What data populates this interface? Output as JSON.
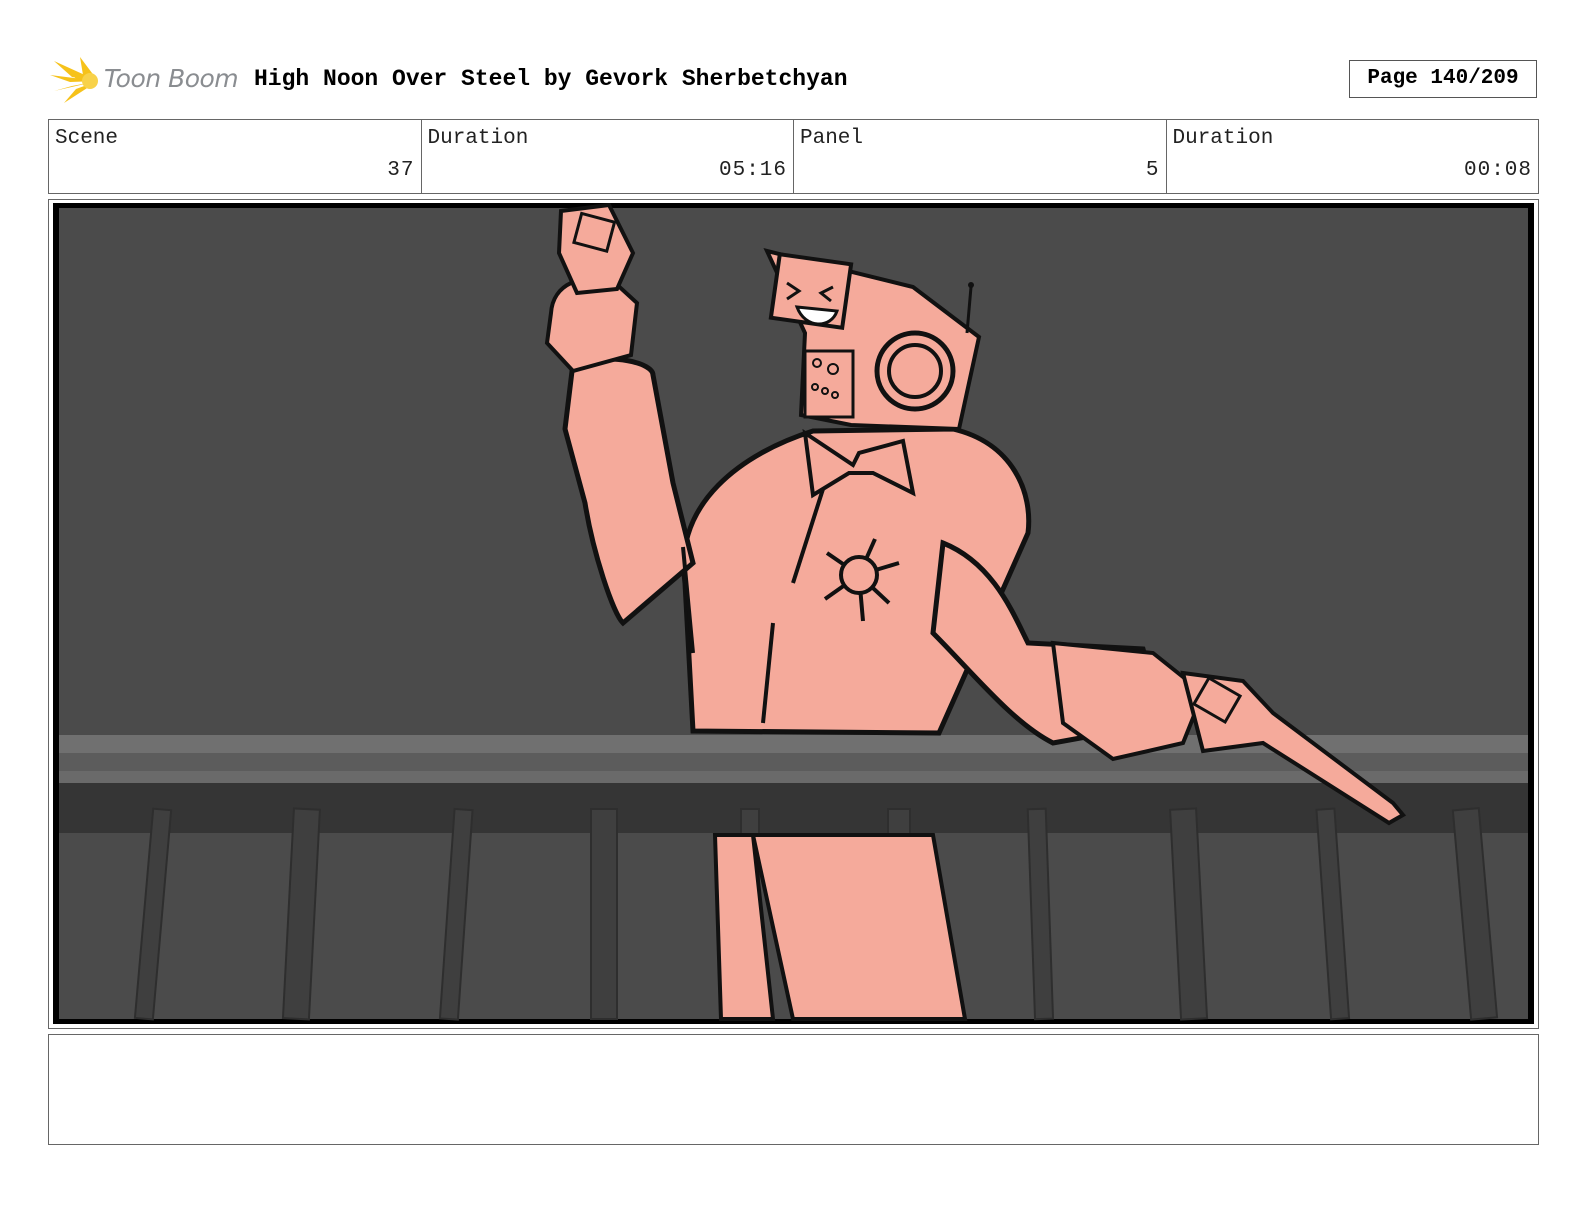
{
  "header": {
    "logo_text": "Toon Boom",
    "title": "High Noon Over Steel by Gevork Sherbetchyan",
    "page": "Page 140/209"
  },
  "info": {
    "scene_label": "Scene",
    "scene_value": "37",
    "scene_duration_label": "Duration",
    "scene_duration_value": "05:16",
    "panel_label": "Panel",
    "panel_value": "5",
    "panel_duration_label": "Duration",
    "panel_duration_value": "00:08"
  },
  "notes": {
    "text": ""
  },
  "colors": {
    "character_fill": "#f5aa9b",
    "background": "#4b4b4b",
    "logo_burst": "#f6c21a"
  }
}
